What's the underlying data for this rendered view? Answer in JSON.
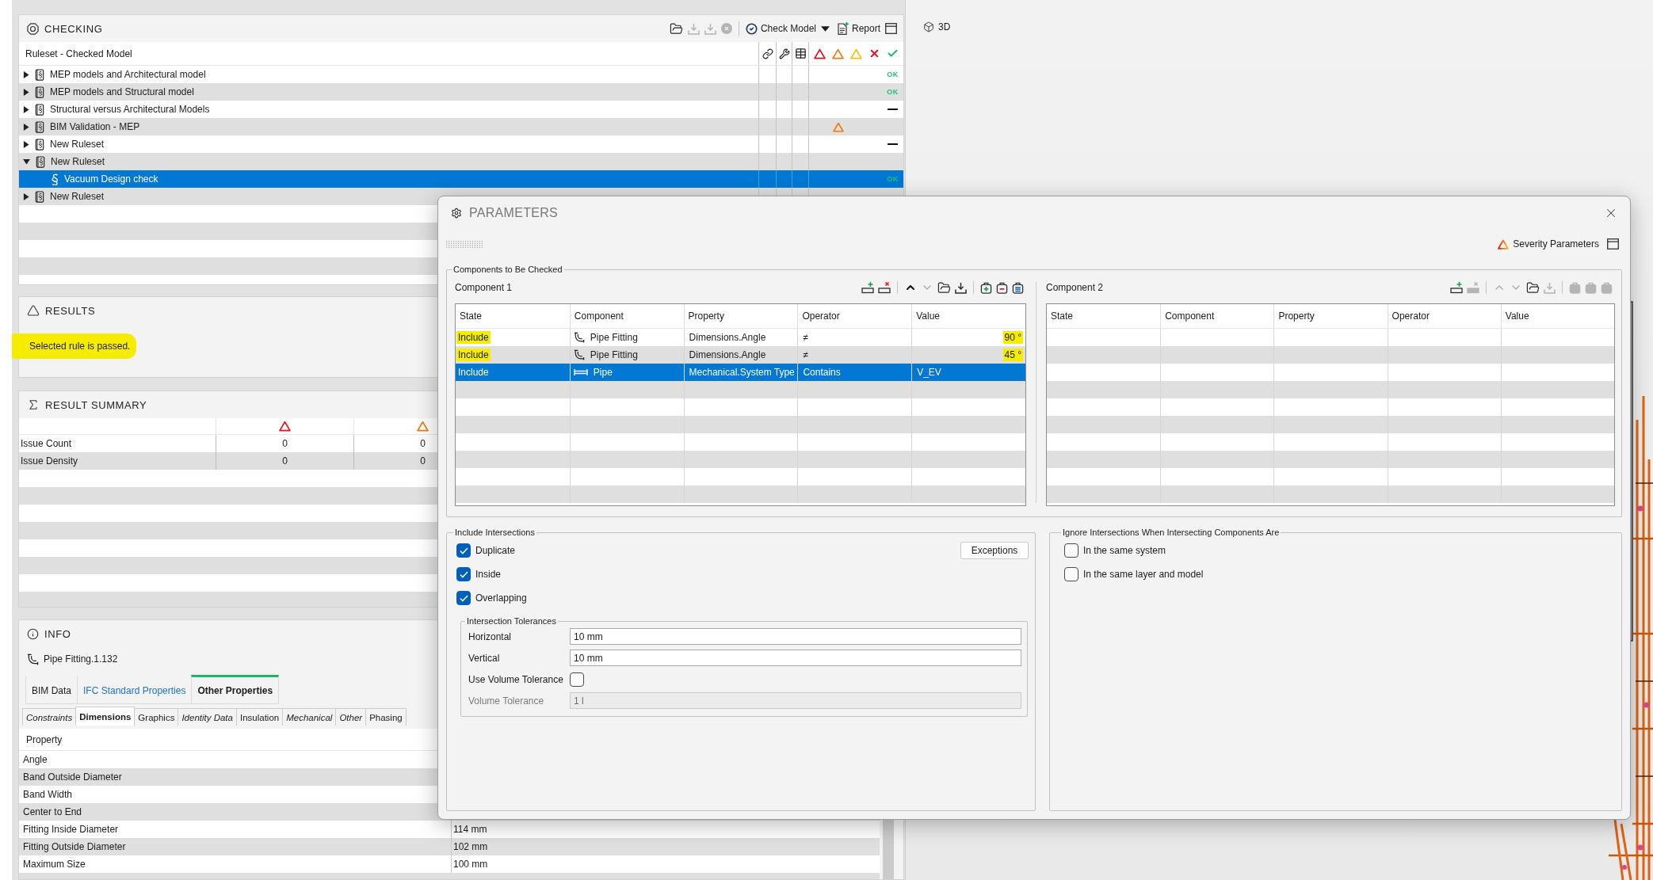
{
  "checking": {
    "title": "CHECKING",
    "tools": [
      {
        "kind": "open",
        "disabled": false
      },
      {
        "kind": "export",
        "disabled": true
      },
      {
        "kind": "export",
        "disabled": true
      },
      {
        "kind": "stop",
        "disabled": true
      }
    ],
    "check_model": "Check Model",
    "report": "Report",
    "tree": {
      "header": "Ruleset - Checked Model",
      "rulesets": [
        {
          "label": "MEP models and Architectural model",
          "expanded": false,
          "selected": false,
          "result": {
            "kind": "passed",
            "text": "OK"
          }
        },
        {
          "label": "MEP models and Structural model",
          "expanded": false,
          "selected": false,
          "result": {
            "kind": "passed",
            "text": "OK"
          }
        },
        {
          "label": "Structural versus Architectural Models",
          "expanded": false,
          "selected": false,
          "result": {
            "kind": "empty"
          }
        },
        {
          "label": "BIM Validation - MEP",
          "expanded": false,
          "selected": false,
          "result": {
            "kind": "moderate"
          }
        },
        {
          "label": "New Ruleset",
          "expanded": false,
          "selected": false,
          "result": {
            "kind": "empty"
          }
        },
        {
          "label": "New Ruleset",
          "expanded": true,
          "selected": false,
          "children": [
            {
              "label": "Vacuum Design check",
              "selected": true,
              "result": {
                "kind": "passed",
                "text": "OK"
              }
            }
          ]
        },
        {
          "label": "New Ruleset",
          "expanded": false,
          "selected": false
        }
      ]
    }
  },
  "results": {
    "title": "RESULTS",
    "message": "Selected rule is passed.",
    "highlighted": true
  },
  "result_summary": {
    "title": "RESULT SUMMARY",
    "columns": [
      {
        "kind": "critical"
      },
      {
        "kind": "moderate"
      }
    ],
    "rows": [
      {
        "label": "Issue Count",
        "values": [
          "0",
          "0"
        ]
      },
      {
        "label": "Issue Density",
        "values": [
          "0",
          "0"
        ]
      }
    ]
  },
  "info": {
    "title": "INFO",
    "object": "Pipe Fitting.1.132",
    "tabs": [
      {
        "label": "BIM Data",
        "selected": false,
        "hovered": false
      },
      {
        "label": "IFC Standard Properties",
        "selected": false,
        "hovered": true
      },
      {
        "label": "Other Properties",
        "selected": true,
        "hovered": false
      }
    ],
    "sub_tabs": [
      {
        "label": "Constraints",
        "selected": false,
        "italic": true
      },
      {
        "label": "Dimensions",
        "selected": true,
        "italic": false
      },
      {
        "label": "Graphics",
        "selected": false,
        "italic": false
      },
      {
        "label": "Identity Data",
        "selected": false,
        "italic": true
      },
      {
        "label": "Insulation",
        "selected": false,
        "italic": false
      },
      {
        "label": "Mechanical",
        "selected": false,
        "italic": true
      },
      {
        "label": "Other",
        "selected": false,
        "italic": true
      },
      {
        "label": "Phasing",
        "selected": false,
        "italic": false
      }
    ],
    "table": {
      "header": "Property",
      "rows": [
        {
          "property": "Angle"
        },
        {
          "property": "Band Outside Diameter"
        },
        {
          "property": "Band Width"
        },
        {
          "property": "Center to End"
        },
        {
          "property": "Fitting Inside Diameter",
          "value": "114 mm"
        },
        {
          "property": "Fitting Outside Diameter",
          "value": "102 mm"
        },
        {
          "property": "Maximum Size",
          "value": "100 mm"
        }
      ]
    }
  },
  "viewport": {
    "title": "3D"
  },
  "dialog": {
    "title": "PARAMETERS",
    "severity_parameters": "Severity Parameters",
    "components_group": {
      "legend": "Components to Be Checked",
      "components": [
        {
          "label": "Component 1",
          "tools": [
            {
              "kind": "add-row",
              "disabled": false
            },
            {
              "kind": "remove-row",
              "disabled": false
            },
            {
              "kind": "move-up",
              "disabled": false
            },
            {
              "kind": "move-down",
              "disabled": true
            },
            {
              "kind": "open",
              "disabled": false
            },
            {
              "kind": "save",
              "disabled": false
            },
            {
              "kind": "clip-add",
              "disabled": false
            },
            {
              "kind": "clip-remove",
              "disabled": false
            },
            {
              "kind": "clip-edit",
              "disabled": false
            }
          ],
          "columns": [
            "State",
            "Component",
            "Property",
            "Operator",
            "Value"
          ],
          "rows": [
            {
              "state": "Include",
              "component": {
                "kind": "fitting",
                "text": "Pipe Fitting"
              },
              "property": "Dimensions.Angle",
              "operator": "≠",
              "value": "90 °",
              "numeric": true,
              "selected": false,
              "highlighted": true
            },
            {
              "state": "Include",
              "component": {
                "kind": "fitting",
                "text": "Pipe Fitting"
              },
              "property": "Dimensions.Angle",
              "operator": "≠",
              "value": "45 °",
              "numeric": true,
              "selected": false,
              "highlighted": true
            },
            {
              "state": "Include",
              "component": {
                "kind": "pipe",
                "text": "Pipe"
              },
              "property": "Mechanical.System Type",
              "operator": "Contains",
              "value": "V_EV",
              "numeric": false,
              "selected": true,
              "highlighted": false
            }
          ]
        },
        {
          "label": "Component 2",
          "tools": [
            {
              "kind": "add-row",
              "disabled": false
            },
            {
              "kind": "remove-row",
              "disabled": true
            },
            {
              "kind": "move-up",
              "disabled": true
            },
            {
              "kind": "move-down",
              "disabled": true
            },
            {
              "kind": "open",
              "disabled": false
            },
            {
              "kind": "save",
              "disabled": true
            },
            {
              "kind": "clip-add",
              "disabled": true
            },
            {
              "kind": "clip-remove",
              "disabled": true
            },
            {
              "kind": "clip-edit",
              "disabled": true
            }
          ],
          "columns": [
            "State",
            "Component",
            "Property",
            "Operator",
            "Value"
          ]
        }
      ]
    },
    "include_group": {
      "legend": "Include Intersections",
      "options": [
        {
          "label": "Duplicate",
          "checked": true
        },
        {
          "label": "Inside",
          "checked": true
        },
        {
          "label": "Overlapping",
          "checked": true
        }
      ],
      "exceptions": "Exceptions",
      "tolerances": {
        "legend": "Intersection Tolerances",
        "fields": [
          {
            "kind": "text",
            "label": "Horizontal",
            "value": "10 mm",
            "disabled": false
          },
          {
            "kind": "text",
            "label": "Vertical",
            "value": "10 mm",
            "disabled": false
          },
          {
            "kind": "checkbox",
            "label": "Use Volume Tolerance",
            "checked": false
          },
          {
            "kind": "text",
            "label": "Volume Tolerance",
            "value": "1 l",
            "disabled": true
          }
        ]
      }
    },
    "ignore_group": {
      "legend": "Ignore Intersections When Intersecting Components Are",
      "options": [
        {
          "label": "In the same system",
          "checked": false
        },
        {
          "label": "In the same layer and model",
          "checked": false
        }
      ]
    }
  }
}
